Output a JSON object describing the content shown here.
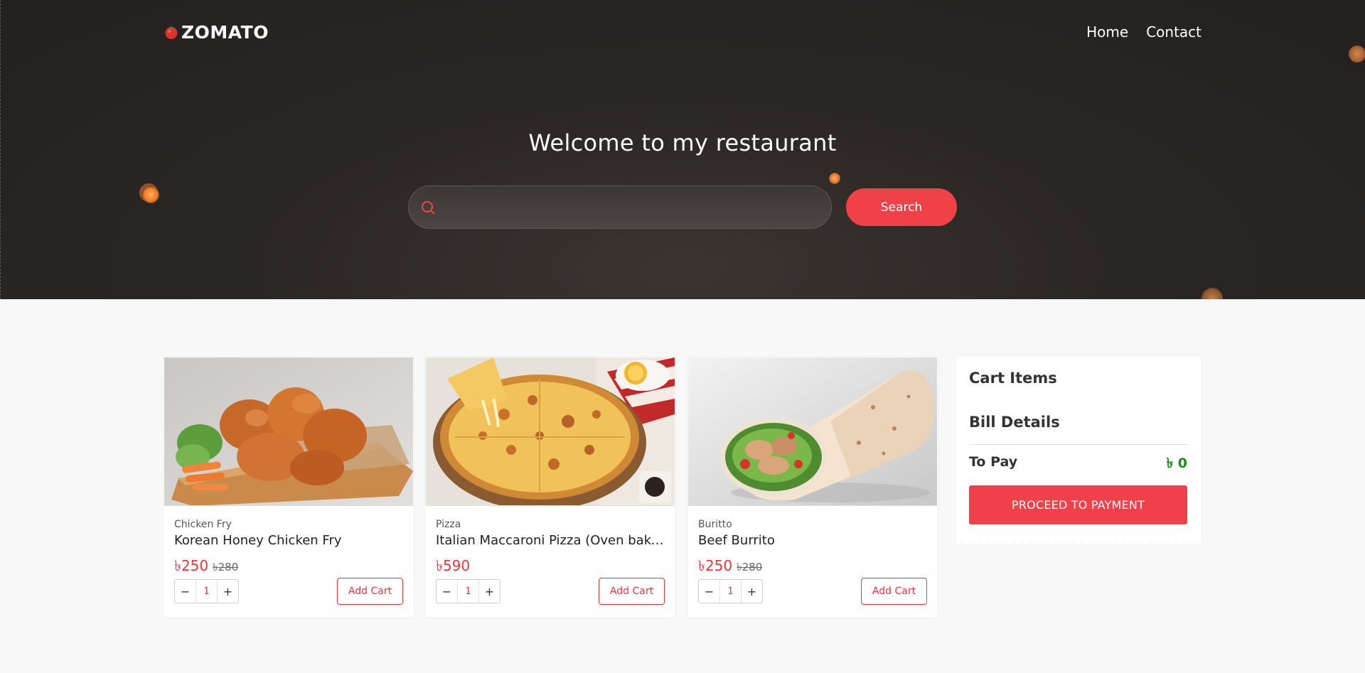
{
  "header": {
    "brand": "ZOMATO",
    "nav": [
      {
        "label": "Home"
      },
      {
        "label": "Contact"
      }
    ]
  },
  "hero": {
    "title": "Welcome to my restaurant",
    "search": {
      "value": "",
      "placeholder": ""
    },
    "search_button": "Search"
  },
  "products": [
    {
      "category": "Chicken Fry",
      "name": "Korean Honey Chicken Fry",
      "price": "৳250",
      "old_price": "৳280",
      "quantity": "1",
      "add_label": "Add Cart",
      "image_icon": "fried-chicken-image"
    },
    {
      "category": "Pizza",
      "name": "Italian Maccaroni Pizza (Oven baked)",
      "price": "৳590",
      "old_price": "",
      "quantity": "1",
      "add_label": "Add Cart",
      "image_icon": "pizza-image"
    },
    {
      "category": "Buritto",
      "name": "Beef Burrito",
      "price": "৳250",
      "old_price": "৳280",
      "quantity": "1",
      "add_label": "Add Cart",
      "image_icon": "burrito-image"
    }
  ],
  "stepper": {
    "minus": "−",
    "plus": "+"
  },
  "cart": {
    "title": "Cart Items",
    "bill_title": "Bill Details",
    "to_pay_label": "To Pay",
    "to_pay_value": "৳ 0",
    "proceed_label": "PROCEED TO PAYMENT"
  },
  "colors": {
    "accent": "#f04148",
    "hero_bg": "#2a2624",
    "price_green": "#1e8a1e"
  }
}
